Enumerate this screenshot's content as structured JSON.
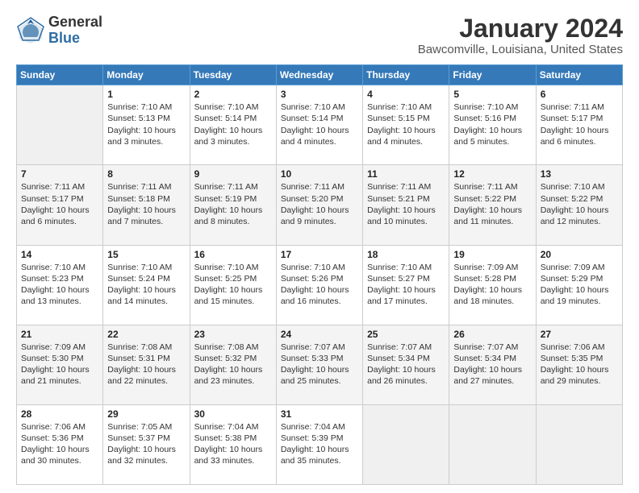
{
  "header": {
    "logo_general": "General",
    "logo_blue": "Blue",
    "month_title": "January 2024",
    "location": "Bawcomville, Louisiana, United States"
  },
  "days_of_week": [
    "Sunday",
    "Monday",
    "Tuesday",
    "Wednesday",
    "Thursday",
    "Friday",
    "Saturday"
  ],
  "weeks": [
    [
      {
        "day": "",
        "info": ""
      },
      {
        "day": "1",
        "info": "Sunrise: 7:10 AM\nSunset: 5:13 PM\nDaylight: 10 hours\nand 3 minutes."
      },
      {
        "day": "2",
        "info": "Sunrise: 7:10 AM\nSunset: 5:14 PM\nDaylight: 10 hours\nand 3 minutes."
      },
      {
        "day": "3",
        "info": "Sunrise: 7:10 AM\nSunset: 5:14 PM\nDaylight: 10 hours\nand 4 minutes."
      },
      {
        "day": "4",
        "info": "Sunrise: 7:10 AM\nSunset: 5:15 PM\nDaylight: 10 hours\nand 4 minutes."
      },
      {
        "day": "5",
        "info": "Sunrise: 7:10 AM\nSunset: 5:16 PM\nDaylight: 10 hours\nand 5 minutes."
      },
      {
        "day": "6",
        "info": "Sunrise: 7:11 AM\nSunset: 5:17 PM\nDaylight: 10 hours\nand 6 minutes."
      }
    ],
    [
      {
        "day": "7",
        "info": "Sunrise: 7:11 AM\nSunset: 5:17 PM\nDaylight: 10 hours\nand 6 minutes."
      },
      {
        "day": "8",
        "info": "Sunrise: 7:11 AM\nSunset: 5:18 PM\nDaylight: 10 hours\nand 7 minutes."
      },
      {
        "day": "9",
        "info": "Sunrise: 7:11 AM\nSunset: 5:19 PM\nDaylight: 10 hours\nand 8 minutes."
      },
      {
        "day": "10",
        "info": "Sunrise: 7:11 AM\nSunset: 5:20 PM\nDaylight: 10 hours\nand 9 minutes."
      },
      {
        "day": "11",
        "info": "Sunrise: 7:11 AM\nSunset: 5:21 PM\nDaylight: 10 hours\nand 10 minutes."
      },
      {
        "day": "12",
        "info": "Sunrise: 7:11 AM\nSunset: 5:22 PM\nDaylight: 10 hours\nand 11 minutes."
      },
      {
        "day": "13",
        "info": "Sunrise: 7:10 AM\nSunset: 5:22 PM\nDaylight: 10 hours\nand 12 minutes."
      }
    ],
    [
      {
        "day": "14",
        "info": "Sunrise: 7:10 AM\nSunset: 5:23 PM\nDaylight: 10 hours\nand 13 minutes."
      },
      {
        "day": "15",
        "info": "Sunrise: 7:10 AM\nSunset: 5:24 PM\nDaylight: 10 hours\nand 14 minutes."
      },
      {
        "day": "16",
        "info": "Sunrise: 7:10 AM\nSunset: 5:25 PM\nDaylight: 10 hours\nand 15 minutes."
      },
      {
        "day": "17",
        "info": "Sunrise: 7:10 AM\nSunset: 5:26 PM\nDaylight: 10 hours\nand 16 minutes."
      },
      {
        "day": "18",
        "info": "Sunrise: 7:10 AM\nSunset: 5:27 PM\nDaylight: 10 hours\nand 17 minutes."
      },
      {
        "day": "19",
        "info": "Sunrise: 7:09 AM\nSunset: 5:28 PM\nDaylight: 10 hours\nand 18 minutes."
      },
      {
        "day": "20",
        "info": "Sunrise: 7:09 AM\nSunset: 5:29 PM\nDaylight: 10 hours\nand 19 minutes."
      }
    ],
    [
      {
        "day": "21",
        "info": "Sunrise: 7:09 AM\nSunset: 5:30 PM\nDaylight: 10 hours\nand 21 minutes."
      },
      {
        "day": "22",
        "info": "Sunrise: 7:08 AM\nSunset: 5:31 PM\nDaylight: 10 hours\nand 22 minutes."
      },
      {
        "day": "23",
        "info": "Sunrise: 7:08 AM\nSunset: 5:32 PM\nDaylight: 10 hours\nand 23 minutes."
      },
      {
        "day": "24",
        "info": "Sunrise: 7:07 AM\nSunset: 5:33 PM\nDaylight: 10 hours\nand 25 minutes."
      },
      {
        "day": "25",
        "info": "Sunrise: 7:07 AM\nSunset: 5:34 PM\nDaylight: 10 hours\nand 26 minutes."
      },
      {
        "day": "26",
        "info": "Sunrise: 7:07 AM\nSunset: 5:34 PM\nDaylight: 10 hours\nand 27 minutes."
      },
      {
        "day": "27",
        "info": "Sunrise: 7:06 AM\nSunset: 5:35 PM\nDaylight: 10 hours\nand 29 minutes."
      }
    ],
    [
      {
        "day": "28",
        "info": "Sunrise: 7:06 AM\nSunset: 5:36 PM\nDaylight: 10 hours\nand 30 minutes."
      },
      {
        "day": "29",
        "info": "Sunrise: 7:05 AM\nSunset: 5:37 PM\nDaylight: 10 hours\nand 32 minutes."
      },
      {
        "day": "30",
        "info": "Sunrise: 7:04 AM\nSunset: 5:38 PM\nDaylight: 10 hours\nand 33 minutes."
      },
      {
        "day": "31",
        "info": "Sunrise: 7:04 AM\nSunset: 5:39 PM\nDaylight: 10 hours\nand 35 minutes."
      },
      {
        "day": "",
        "info": ""
      },
      {
        "day": "",
        "info": ""
      },
      {
        "day": "",
        "info": ""
      }
    ]
  ]
}
